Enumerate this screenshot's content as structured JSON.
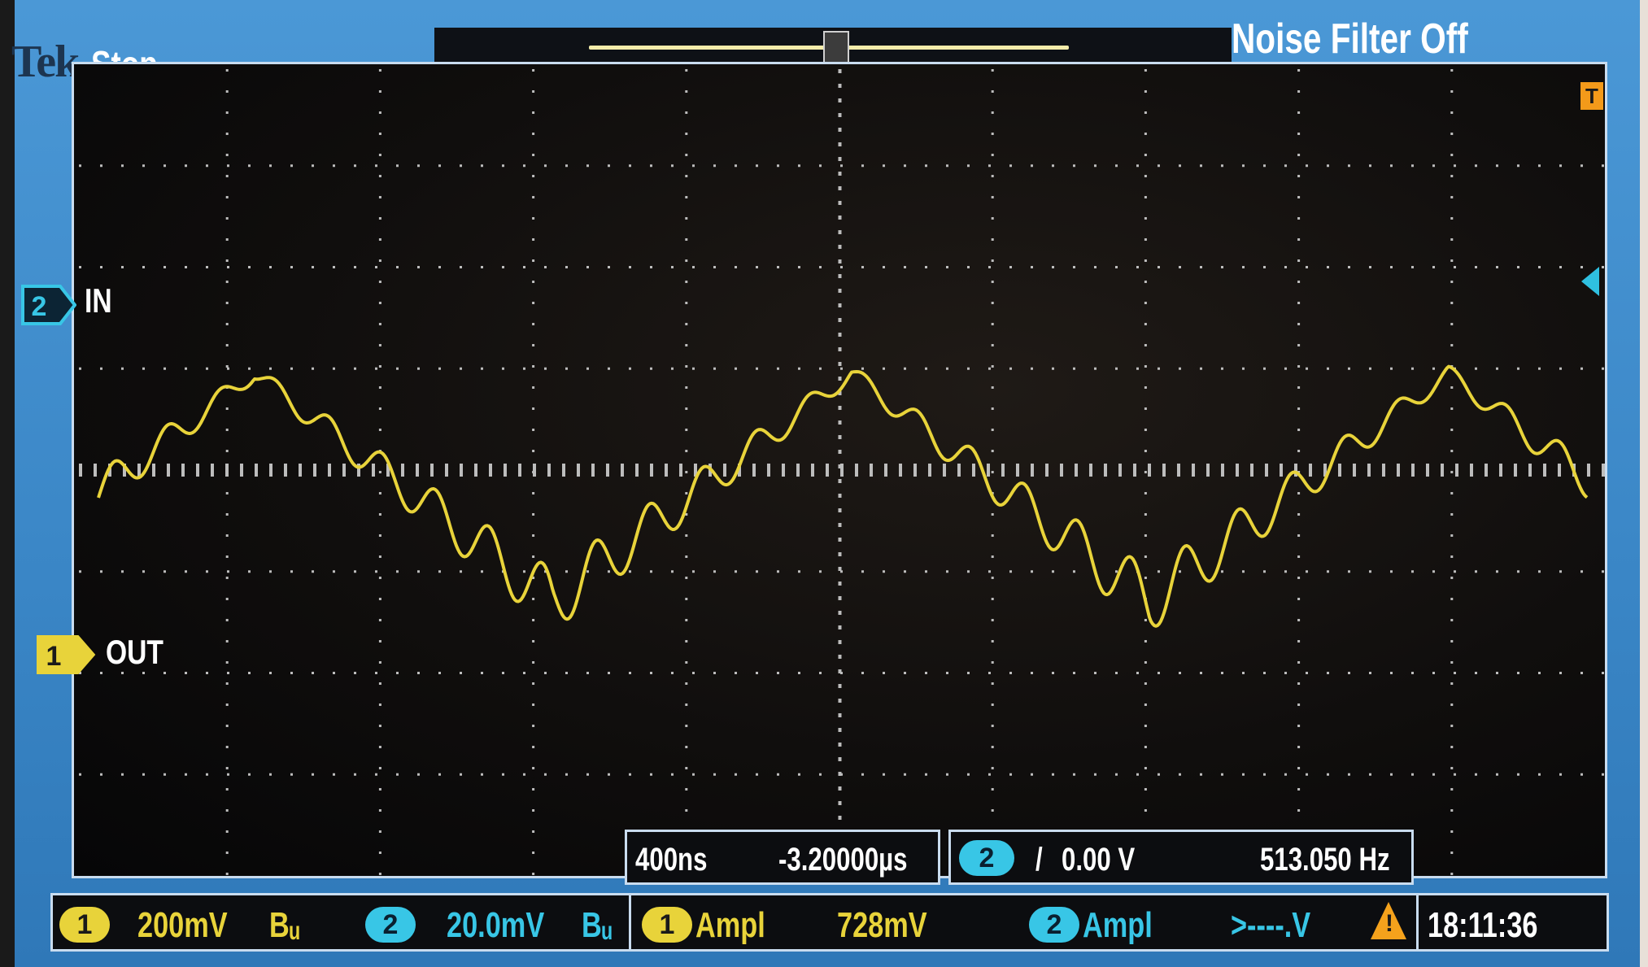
{
  "header": {
    "brand": "Tek",
    "acq_status": "Stop",
    "noise_filter": "Noise Filter Off"
  },
  "channels": {
    "ch2": {
      "number": "2",
      "label": "IN",
      "color": "#38c6e6"
    },
    "ch1": {
      "number": "1",
      "label": "OUT",
      "color": "#e8d33a"
    }
  },
  "trigger": {
    "position_marker": "T",
    "horizontal_scale": "400ns",
    "horizontal_delay": "-3.20000µs",
    "source": "2",
    "slope_icon": "rising-edge-icon",
    "slope": "/",
    "level": "0.00 V",
    "frequency": "513.050 Hz"
  },
  "bottom": {
    "ch1_number": "1",
    "ch1_scale": "200mV",
    "ch1_bw": "Bᵤ",
    "ch2_number": "2",
    "ch2_scale": "20.0mV",
    "ch2_bw": "Bᵤ",
    "meas1_source": "1",
    "meas1_name": "Ampl",
    "meas1_value": "728mV",
    "meas2_source": "2",
    "meas2_name": "Ampl",
    "meas2_value": ">----.V",
    "warning_icon": "warning-icon",
    "time": "18:11:36"
  },
  "grid": {
    "h_divisions": 10,
    "v_divisions": 8
  },
  "waveform": {
    "channel": "1",
    "color": "#e8d33a",
    "shape": "triangle with superimposed ripple",
    "period_divisions": 3.9,
    "ripple_cycles_per_division": 1.3
  }
}
